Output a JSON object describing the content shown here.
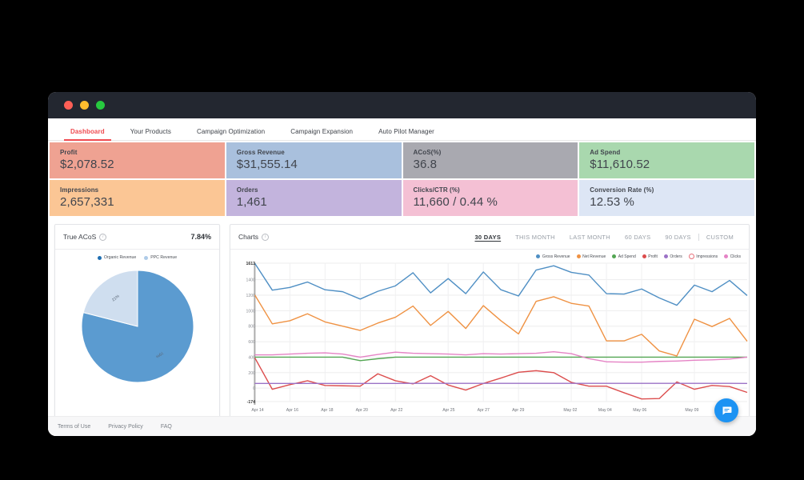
{
  "window": {
    "dots": [
      "close-red",
      "minimize-yellow",
      "maximize-green"
    ]
  },
  "nav": {
    "tabs": [
      {
        "label": "Dashboard",
        "active": true
      },
      {
        "label": "Your Products",
        "active": false
      },
      {
        "label": "Campaign Optimization",
        "active": false
      },
      {
        "label": "Campaign Expansion",
        "active": false
      },
      {
        "label": "Auto Pilot Manager",
        "active": false
      }
    ]
  },
  "kpis": [
    {
      "label": "Profit",
      "value": "$2,078.52",
      "color": "#efa292"
    },
    {
      "label": "Gross Revenue",
      "value": "$31,555.14",
      "color": "#a9c0dd"
    },
    {
      "label": "ACoS(%)",
      "value": "36.8",
      "color": "#a9a9b0"
    },
    {
      "label": "Ad Spend",
      "value": "$11,610.52",
      "color": "#a9d8ae"
    },
    {
      "label": "Impressions",
      "value": "2,657,331",
      "color": "#fbc695"
    },
    {
      "label": "Orders",
      "value": "1,461",
      "color": "#c3b4dd"
    },
    {
      "label": "Clicks/CTR (%)",
      "value": "11,660 / 0.44 %",
      "color": "#f4c0d4"
    },
    {
      "label": "Conversion Rate (%)",
      "value": "12.53 %",
      "color": "#dde6f5"
    }
  ],
  "true_acos": {
    "title": "True ACoS",
    "value": "7.84%",
    "info_glyph": "i"
  },
  "charts_panel": {
    "title": "Charts",
    "info_glyph": "i",
    "ranges": [
      {
        "label": "30 DAYS",
        "active": true,
        "sep": false
      },
      {
        "label": "THIS MONTH",
        "active": false,
        "sep": false
      },
      {
        "label": "LAST MONTH",
        "active": false,
        "sep": false
      },
      {
        "label": "60 DAYS",
        "active": false,
        "sep": false
      },
      {
        "label": "90 DAYS",
        "active": false,
        "sep": false
      },
      {
        "label": "CUSTOM",
        "active": false,
        "sep": true
      }
    ]
  },
  "footer": {
    "links": [
      "Terms of Use",
      "Privacy Policy",
      "FAQ"
    ]
  },
  "chat": {
    "icon": "chat-bubble-icon"
  },
  "chart_data": [
    {
      "type": "pie",
      "title": "True ACoS",
      "legend_position": "top",
      "categories": [
        "Organic Revenue",
        "PPC Revenue"
      ],
      "values": [
        79,
        21
      ],
      "labels": [
        "79%",
        "21%"
      ],
      "colors": [
        "#5b9bd0",
        "#cfdeef"
      ]
    },
    {
      "type": "line",
      "title": "Charts",
      "xlabel": "",
      "ylabel": "",
      "ylim": [
        -174,
        1613
      ],
      "yticks": [
        -174,
        0,
        200,
        400,
        600,
        800,
        1000,
        1200,
        1400,
        1613
      ],
      "grid": true,
      "legend_position": "top-right",
      "x": [
        "Apr 14",
        "Apr 15",
        "Apr 16",
        "Apr 17",
        "Apr 18",
        "Apr 19",
        "Apr 20",
        "Apr 21",
        "Apr 22",
        "Apr 23",
        "Apr 24",
        "Apr 25",
        "Apr 26",
        "Apr 27",
        "Apr 28",
        "Apr 29",
        "Apr 30",
        "May 01",
        "May 02",
        "May 03",
        "May 04",
        "May 05",
        "May 06",
        "May 07",
        "May 08",
        "May 09",
        "May 10",
        "May 11",
        "May 12"
      ],
      "xticks": [
        "Apr 14",
        "Apr 16",
        "Apr 18",
        "Apr 20",
        "Apr 22",
        "Apr 25",
        "Apr 27",
        "Apr 29",
        "May 02",
        "May 04",
        "May 06",
        "May 09"
      ],
      "series": [
        {
          "name": "Gross Revenue",
          "color": "#4f8fc4",
          "values": [
            1613,
            1265,
            1300,
            1370,
            1270,
            1245,
            1150,
            1250,
            1320,
            1490,
            1230,
            1415,
            1220,
            1500,
            1270,
            1190,
            1525,
            1580,
            1495,
            1460,
            1220,
            1215,
            1280,
            1165,
            1070,
            1330,
            1245,
            1390,
            1195
          ]
        },
        {
          "name": "Net Revenue",
          "color": "#ef9243",
          "values": [
            1205,
            830,
            870,
            960,
            855,
            800,
            745,
            840,
            915,
            1060,
            810,
            990,
            770,
            1065,
            870,
            700,
            1120,
            1180,
            1095,
            1060,
            610,
            610,
            695,
            480,
            415,
            890,
            795,
            900,
            605
          ]
        },
        {
          "name": "Ad Spend",
          "color": "#53a653",
          "values": [
            400,
            400,
            400,
            400,
            400,
            400,
            355,
            380,
            400,
            400,
            400,
            400,
            400,
            400,
            400,
            400,
            400,
            400,
            400,
            400,
            400,
            400,
            400,
            400,
            400,
            400,
            400,
            400,
            400
          ]
        },
        {
          "name": "Profit",
          "color": "#dc4d4d",
          "values": [
            395,
            -15,
            45,
            95,
            35,
            30,
            25,
            185,
            95,
            55,
            160,
            40,
            -25,
            60,
            130,
            205,
            225,
            200,
            75,
            25,
            25,
            -60,
            -140,
            -135,
            80,
            -15,
            35,
            20,
            -55
          ]
        },
        {
          "name": "Orders",
          "color": "#9b72c6",
          "values": [
            60,
            60,
            60,
            60,
            60,
            60,
            60,
            60,
            60,
            62,
            62,
            62,
            62,
            62,
            62,
            62,
            62,
            62,
            62,
            62,
            62,
            62,
            62,
            62,
            62,
            62,
            62,
            62,
            60
          ]
        },
        {
          "name": "Impressions",
          "color": "#e8717a",
          "hollow": true,
          "values": [
            0,
            0,
            0,
            0,
            0,
            0,
            0,
            0,
            0,
            0,
            0,
            0,
            0,
            0,
            0,
            0,
            0,
            0,
            0,
            0,
            0,
            0,
            0,
            0,
            0,
            0,
            0,
            0,
            0
          ]
        },
        {
          "name": "Clicks",
          "color": "#e583c5",
          "values": [
            430,
            430,
            440,
            450,
            455,
            440,
            400,
            435,
            465,
            450,
            445,
            440,
            430,
            445,
            440,
            445,
            450,
            470,
            445,
            380,
            340,
            335,
            335,
            345,
            350,
            360,
            365,
            375,
            400
          ]
        }
      ]
    }
  ]
}
